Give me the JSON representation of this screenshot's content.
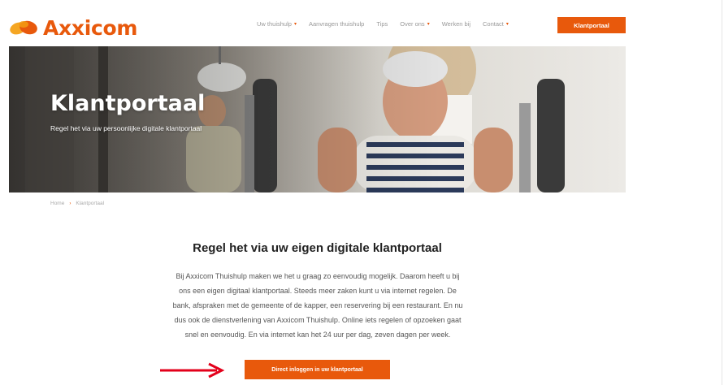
{
  "header": {
    "logo_text": "Axxicom",
    "nav": [
      {
        "label": "Uw thuishulp",
        "has_dropdown": true
      },
      {
        "label": "Aanvragen thuishulp",
        "has_dropdown": false
      },
      {
        "label": "Tips",
        "has_dropdown": false
      },
      {
        "label": "Over ons",
        "has_dropdown": true
      },
      {
        "label": "Werken bij",
        "has_dropdown": false
      },
      {
        "label": "Contact",
        "has_dropdown": true
      }
    ],
    "cta_label": "Klantportaal"
  },
  "hero": {
    "title": "Klantportaal",
    "subtitle": "Regel het via uw persoonlijke digitale klantportaal"
  },
  "breadcrumb": {
    "home": "Home",
    "current": "Klantportaal"
  },
  "main": {
    "title": "Regel het via uw eigen digitale klantportaal",
    "lines": [
      "Bij Axxicom Thuishulp maken we het u graag zo eenvoudig mogelijk. Daarom heeft u bij",
      "ons een eigen digitaal klantportaal. Steeds meer zaken kunt u via internet regelen. De",
      "bank, afspraken met de gemeente of de kapper, een reservering bij een restaurant. En nu",
      "dus ook de dienstverlening van Axxicom Thuishulp. Online iets regelen of opzoeken gaat",
      "snel en eenvoudig. En via internet kan het 24 uur per dag, zeven dagen per week."
    ],
    "button_label": "Direct inloggen in uw klantportaal"
  },
  "colors": {
    "brand": "#e8590c",
    "arrow": "#e3001b"
  }
}
